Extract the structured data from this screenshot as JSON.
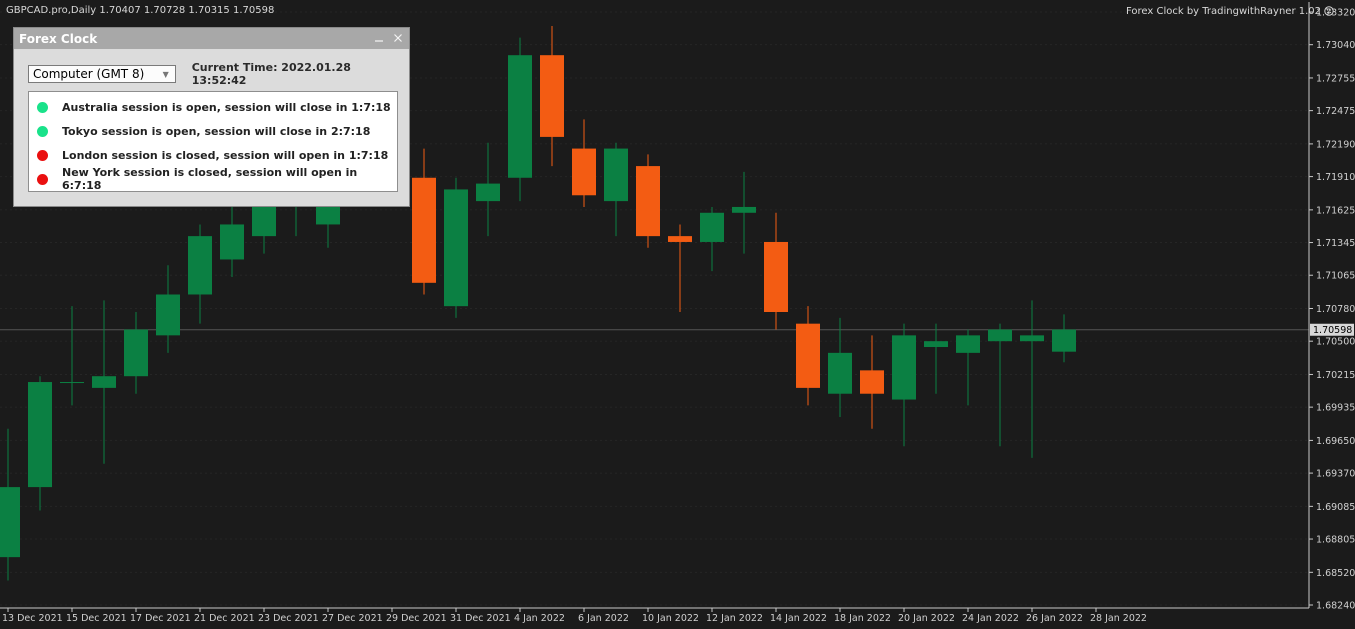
{
  "header": {
    "symbol_info": "GBPCAD.pro,Daily  1.70407 1.70728 1.70315 1.70598",
    "indicator_label": "Forex Clock by TradingwithRayner 1.02",
    "smiley_icon": "smiley-icon"
  },
  "forex_clock": {
    "title": "Forex Clock",
    "minimize_icon": "minimize-icon",
    "close_icon": "close-icon",
    "timezone_select": "Computer (GMT 8)",
    "current_time": "Current Time: 2022.01.28 13:52:42",
    "sessions": [
      {
        "text": "Australia session is open, session will close in 1:7:18",
        "status": "open",
        "color": "#19e28a"
      },
      {
        "text": "Tokyo session is open, session will close in 2:7:18",
        "status": "open",
        "color": "#19e28a"
      },
      {
        "text": "London session is closed, session will open in 1:7:18",
        "status": "closed",
        "color": "#ea1010"
      },
      {
        "text": "New York session is closed, session will open in 6:7:18",
        "status": "closed",
        "color": "#ea1010"
      }
    ]
  },
  "chart_data": {
    "type": "candlestick",
    "symbol": "GBPCAD.pro",
    "timeframe": "Daily",
    "bull_color": "#0b8043",
    "bear_color": "#f35c13",
    "ylim": [
      1.681,
      1.734
    ],
    "y_ticks": [
      "1.73320",
      "1.73040",
      "1.72755",
      "1.72475",
      "1.72190",
      "1.71910",
      "1.71625",
      "1.71345",
      "1.71065",
      "1.70780",
      "1.70500",
      "1.70215",
      "1.69935",
      "1.69650",
      "1.69370",
      "1.69085",
      "1.68805",
      "1.68520",
      "1.68240"
    ],
    "current_price": "1.70598",
    "x_labels": [
      "13 Dec 2021",
      "15 Dec 2021",
      "17 Dec 2021",
      "21 Dec 2021",
      "23 Dec 2021",
      "27 Dec 2021",
      "29 Dec 2021",
      "31 Dec 2021",
      "4 Jan 2022",
      "6 Jan 2022",
      "10 Jan 2022",
      "12 Jan 2022",
      "14 Jan 2022",
      "18 Jan 2022",
      "20 Jan 2022",
      "24 Jan 2022",
      "26 Jan 2022",
      "28 Jan 2022"
    ],
    "candles": [
      {
        "o": 1.6865,
        "h": 1.6975,
        "l": 1.6845,
        "c": 1.6925
      },
      {
        "o": 1.6925,
        "h": 1.702,
        "l": 1.6905,
        "c": 1.7015
      },
      {
        "o": 1.7015,
        "h": 1.708,
        "l": 1.6995,
        "c": 1.7015
      },
      {
        "o": 1.701,
        "h": 1.7085,
        "l": 1.6945,
        "c": 1.702
      },
      {
        "o": 1.702,
        "h": 1.7075,
        "l": 1.7005,
        "c": 1.706
      },
      {
        "o": 1.7055,
        "h": 1.7115,
        "l": 1.704,
        "c": 1.709
      },
      {
        "o": 1.709,
        "h": 1.715,
        "l": 1.7065,
        "c": 1.714
      },
      {
        "o": 1.712,
        "h": 1.7175,
        "l": 1.7105,
        "c": 1.715
      },
      {
        "o": 1.714,
        "h": 1.7205,
        "l": 1.7125,
        "c": 1.717
      },
      {
        "o": 1.717,
        "h": 1.722,
        "l": 1.714,
        "c": 1.7195
      },
      {
        "o": 1.715,
        "h": 1.721,
        "l": 1.713,
        "c": 1.718
      },
      {
        "o": 1.72,
        "h": 1.729,
        "l": 1.718,
        "c": 1.725
      },
      {
        "o": 1.725,
        "h": 1.7265,
        "l": 1.718,
        "c": 1.719
      },
      {
        "o": 1.719,
        "h": 1.7215,
        "l": 1.709,
        "c": 1.71
      },
      {
        "o": 1.708,
        "h": 1.719,
        "l": 1.707,
        "c": 1.718
      },
      {
        "o": 1.717,
        "h": 1.722,
        "l": 1.714,
        "c": 1.7185
      },
      {
        "o": 1.719,
        "h": 1.731,
        "l": 1.717,
        "c": 1.7295
      },
      {
        "o": 1.7295,
        "h": 1.732,
        "l": 1.72,
        "c": 1.7225
      },
      {
        "o": 1.7215,
        "h": 1.724,
        "l": 1.7165,
        "c": 1.7175
      },
      {
        "o": 1.717,
        "h": 1.722,
        "l": 1.714,
        "c": 1.7215
      },
      {
        "o": 1.72,
        "h": 1.721,
        "l": 1.713,
        "c": 1.714
      },
      {
        "o": 1.714,
        "h": 1.715,
        "l": 1.7075,
        "c": 1.7135
      },
      {
        "o": 1.7135,
        "h": 1.7165,
        "l": 1.711,
        "c": 1.716
      },
      {
        "o": 1.716,
        "h": 1.7195,
        "l": 1.7125,
        "c": 1.7165
      },
      {
        "o": 1.7135,
        "h": 1.716,
        "l": 1.706,
        "c": 1.7075
      },
      {
        "o": 1.7065,
        "h": 1.708,
        "l": 1.6995,
        "c": 1.701
      },
      {
        "o": 1.7005,
        "h": 1.707,
        "l": 1.6985,
        "c": 1.704
      },
      {
        "o": 1.7025,
        "h": 1.7055,
        "l": 1.6975,
        "c": 1.7005
      },
      {
        "o": 1.7,
        "h": 1.7065,
        "l": 1.696,
        "c": 1.7055
      },
      {
        "o": 1.7045,
        "h": 1.7065,
        "l": 1.7005,
        "c": 1.705
      },
      {
        "o": 1.704,
        "h": 1.706,
        "l": 1.6995,
        "c": 1.7055
      },
      {
        "o": 1.705,
        "h": 1.7065,
        "l": 1.696,
        "c": 1.706
      },
      {
        "o": 1.705,
        "h": 1.7085,
        "l": 1.695,
        "c": 1.7055
      },
      {
        "o": 1.7041,
        "h": 1.7073,
        "l": 1.7032,
        "c": 1.706
      }
    ]
  }
}
